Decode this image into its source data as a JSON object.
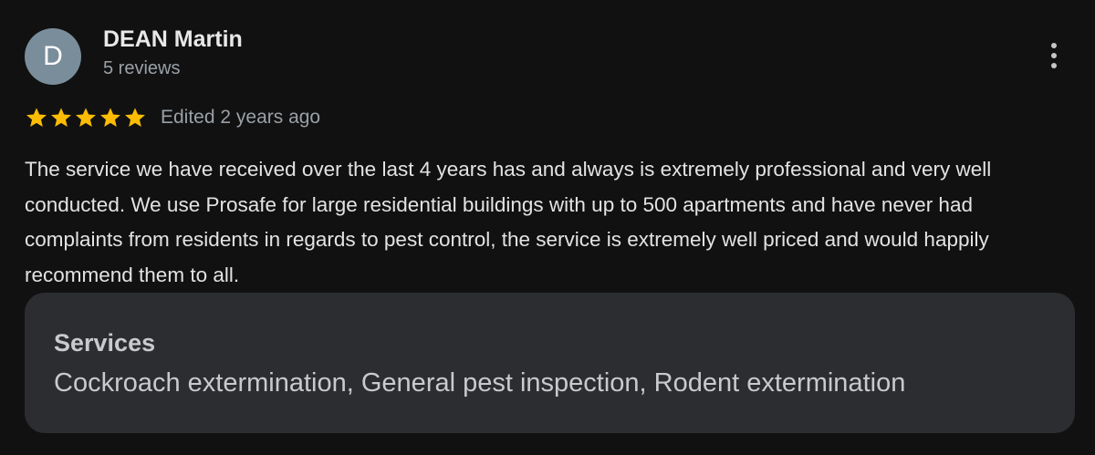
{
  "author": {
    "initial": "D",
    "name": "DEAN Martin",
    "review_count": "5 reviews",
    "avatar_color": "#7a8d9b"
  },
  "menu": {
    "icon": "more-vert-icon"
  },
  "rating": {
    "stars": 5,
    "max_stars": 5,
    "star_color": "#fbbc04",
    "icon": "star-icon",
    "edited": "Edited 2 years ago"
  },
  "review": {
    "text": "The service we have received over the last 4 years has and always is extremely professional and very well conducted. We use Prosafe for large residential buildings with up to 500 apartments and have never had complaints from residents in regards to pest control, the service is extremely well priced and would happily recommend them to all."
  },
  "services": {
    "title": "Services",
    "list": "Cockroach extermination, General pest inspection, Rodent extermination"
  }
}
